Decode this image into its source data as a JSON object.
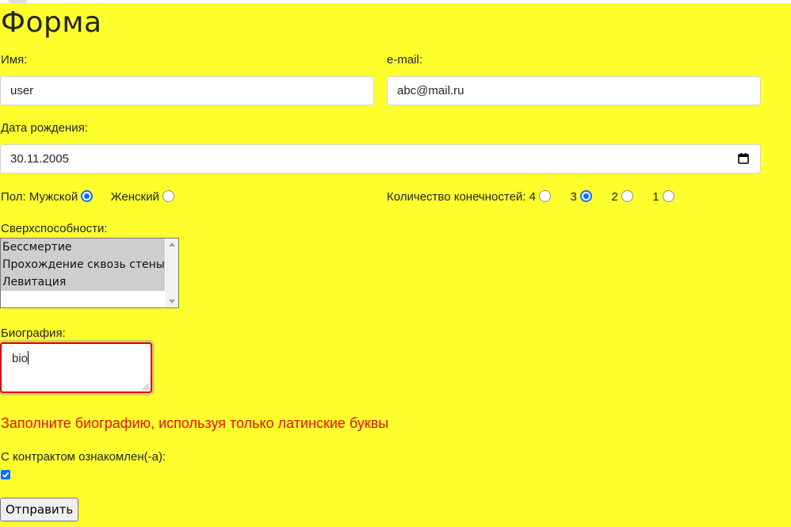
{
  "form": {
    "title": "Форма",
    "name": {
      "label": "Имя:",
      "value": "user"
    },
    "email": {
      "label": "e-mail:",
      "value": "abc@mail.ru"
    },
    "birthdate": {
      "label": "Дата рождения:",
      "value": "30.11.2005",
      "icon": "calendar-icon"
    },
    "gender": {
      "label": "Пол:",
      "options": [
        {
          "label": "Мужской",
          "checked": true
        },
        {
          "label": "Женский",
          "checked": false
        }
      ]
    },
    "limbs": {
      "label": "Количество конечностей:",
      "options": [
        {
          "label": "4",
          "checked": false
        },
        {
          "label": "3",
          "checked": true
        },
        {
          "label": "2",
          "checked": false
        },
        {
          "label": "1",
          "checked": false
        }
      ]
    },
    "superpowers": {
      "label": "Сверхспособности:",
      "options": [
        {
          "label": "Бессмертие",
          "selected": true
        },
        {
          "label": "Прохождение сквозь стены",
          "selected": true
        },
        {
          "label": "Левитация",
          "selected": true
        }
      ]
    },
    "bio": {
      "label": "Биография:",
      "value": "bio"
    },
    "error_message": "Заполните биографию, используя только латинские буквы",
    "contract": {
      "label": "С контрактом ознакомлен(-а):",
      "checked": true
    },
    "submit_label": "Отправить"
  },
  "colors": {
    "background": "#ffff2e",
    "accent": "#0d6efd",
    "error": "#e81010"
  }
}
